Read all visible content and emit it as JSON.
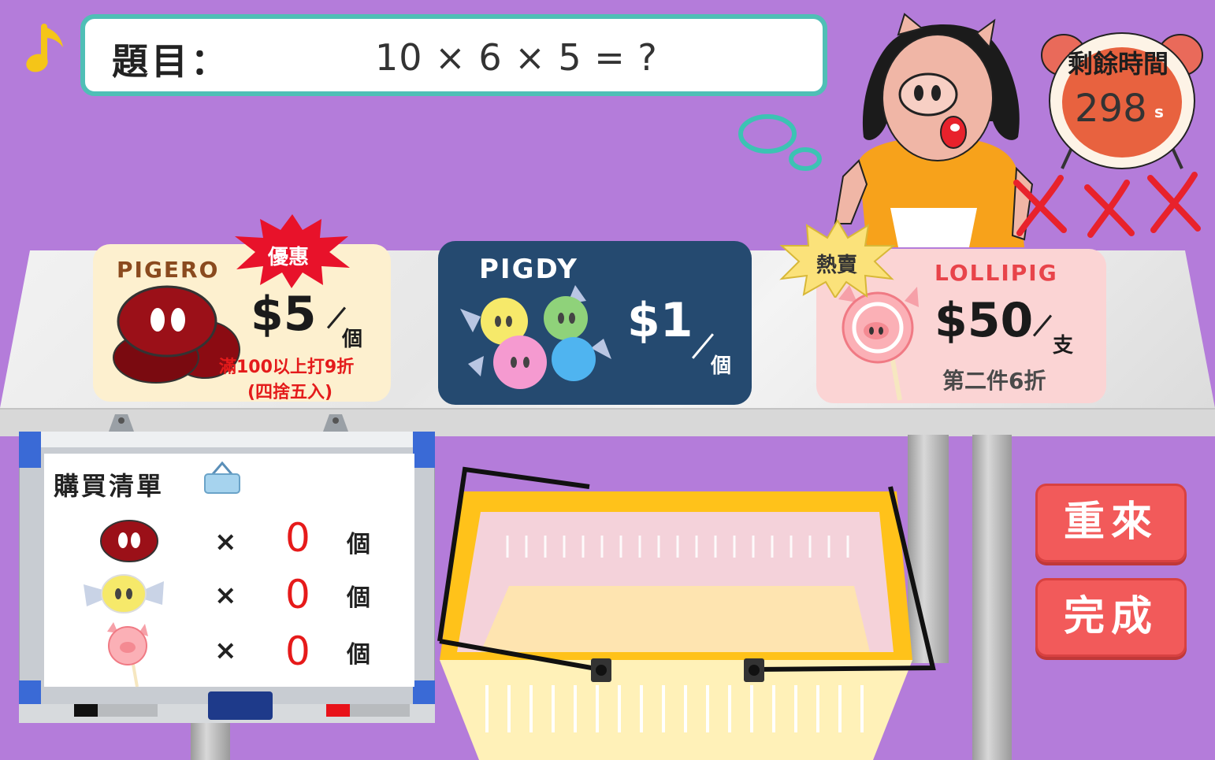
{
  "question": {
    "label": "題目：",
    "expression": "10 × 6 × 5 = ?"
  },
  "timer": {
    "label": "剩餘時間",
    "value": "298",
    "unit": "s"
  },
  "lives_lost": 3,
  "products": [
    {
      "name": "PIGERO",
      "badge": "優惠",
      "price": "$5",
      "unit": "個",
      "note_line1": "滿100以上打9折",
      "note_line2": "(四捨五入)"
    },
    {
      "name": "PIGDY",
      "price": "$1",
      "unit": "個"
    },
    {
      "name": "LOLLIPIG",
      "badge": "熱賣",
      "price": "$50",
      "unit": "支",
      "note_line1": "第二件6折"
    }
  ],
  "shopping_list": {
    "title": "購買清單",
    "items": [
      {
        "icon": "pigero-coin-icon",
        "times": "×",
        "qty": "0",
        "unit": "個"
      },
      {
        "icon": "pigdy-candy-icon",
        "times": "×",
        "qty": "0",
        "unit": "個"
      },
      {
        "icon": "lollipig-icon",
        "times": "×",
        "qty": "0",
        "unit": "個"
      }
    ]
  },
  "buttons": {
    "reset": "重來",
    "done": "完成"
  },
  "colors": {
    "background": "#b47cda",
    "question_border": "#4fbfb6",
    "button": "#f25a5a",
    "qty_red": "#e61a1a",
    "basket_yellow": "#ffc21a",
    "card_pigero": "#fdf0cf",
    "card_pigdy": "#254a70",
    "card_lollipig": "#fbd4d4"
  }
}
